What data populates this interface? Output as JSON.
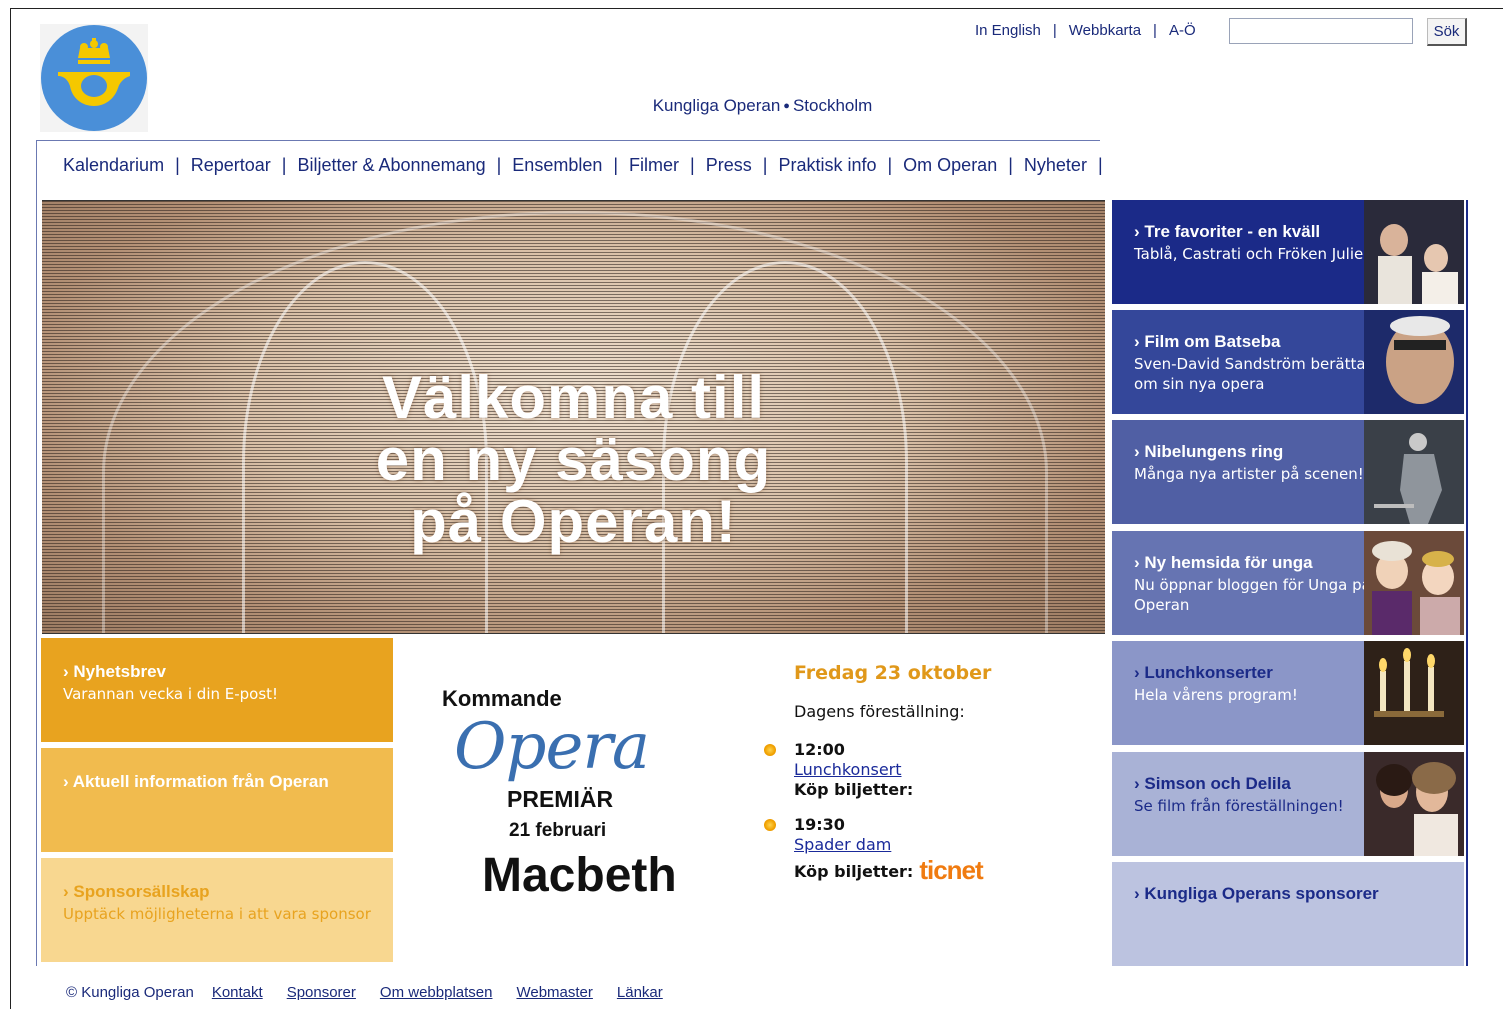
{
  "header": {
    "tagline_left": "Kungliga Operan",
    "tagline_right": "Stockholm",
    "links": [
      {
        "label": "In English"
      },
      {
        "label": "Webbkarta"
      },
      {
        "label": "A-Ö"
      }
    ],
    "search": {
      "value": "",
      "placeholder": "",
      "button_label": "Sök"
    }
  },
  "nav": {
    "items": [
      {
        "label": "Kalendarium"
      },
      {
        "label": "Repertoar"
      },
      {
        "label": "Biljetter & Abonnemang"
      },
      {
        "label": "Ensemblen"
      },
      {
        "label": "Filmer"
      },
      {
        "label": "Press"
      },
      {
        "label": "Praktisk info"
      },
      {
        "label": "Om Operan"
      },
      {
        "label": "Nyheter"
      }
    ]
  },
  "hero": {
    "lines": [
      "Välkomna till",
      "en ny säsong",
      "på Operan!"
    ]
  },
  "side_panels": [
    {
      "title": "Tre favoriter - en kväll",
      "subtitle": "Tablå, Castrati och Fröken Julie",
      "bg": "#1b2a88",
      "text_color": "#ffffff",
      "title_color": "#ffffff",
      "icon": "performers-photo"
    },
    {
      "title": "Film om Batseba",
      "subtitle": "Sven-David Sandström berättar om sin nya opera",
      "bg": "#34479a",
      "text_color": "#ffffff",
      "title_color": "#ffffff",
      "icon": "composer-photo"
    },
    {
      "title": "Nibelungens ring",
      "subtitle": "Många nya artister på scenen!",
      "bg": "#505fa4",
      "text_color": "#ffffff",
      "title_color": "#ffffff",
      "icon": "stage-photo"
    },
    {
      "title": "Ny hemsida för unga",
      "subtitle": "Nu öppnar bloggen för Unga på Operan",
      "bg": "#6674b2",
      "text_color": "#ffffff",
      "title_color": "#ffffff",
      "icon": "kids-photo"
    },
    {
      "title": "Lunchkonserter",
      "subtitle": "Hela vårens program!",
      "bg": "#8b96c8",
      "text_color": "#ffffff",
      "title_color": "#1b2a88",
      "icon": "candles-photo"
    },
    {
      "title": "Simson och Delila",
      "subtitle": "Se film från föreställningen!",
      "bg": "#a9b2d6",
      "text_color": "#1b2a88",
      "title_color": "#1b2a88",
      "icon": "couple-photo"
    },
    {
      "title": "Kungliga Operans sponsorer",
      "subtitle": "",
      "bg": "#bcc3e0",
      "text_color": "#1b2a88",
      "title_color": "#1b2a88",
      "icon": ""
    }
  ],
  "left_panels": [
    {
      "title": "Nyhetsbrev",
      "subtitle": "Varannan vecka i din E-post!",
      "bg": "#e8a31f",
      "color": "#ffffff"
    },
    {
      "title": "Aktuell information från Operan",
      "subtitle": "",
      "bg": "#f1bb4e",
      "color": "#ffffff"
    },
    {
      "title": "Sponsorsällskap",
      "subtitle": "Upptäck möjligheterna i att vara sponsor",
      "bg": "#f8d790",
      "color": "#e8a31f"
    }
  ],
  "promo": {
    "kommande": "Kommande",
    "opera": "Opera",
    "premiar": "PREMIÄR",
    "date": "21 februari",
    "title": "Macbeth"
  },
  "today": {
    "date": "Fredag 23 oktober",
    "label": "Dagens föreställning:",
    "events": [
      {
        "time": "12:00",
        "show": "Lunchkonsert",
        "buy": "Köp biljetter:",
        "vendor": ""
      },
      {
        "time": "19:30",
        "show": "Spader dam",
        "buy": "Köp biljetter:",
        "vendor": "ticnet"
      }
    ]
  },
  "footer": {
    "copyright": "© Kungliga Operan",
    "links": [
      {
        "label": "Kontakt"
      },
      {
        "label": "Sponsorer"
      },
      {
        "label": "Om webbplatsen"
      },
      {
        "label": "Webmaster"
      },
      {
        "label": "Länkar"
      }
    ]
  },
  "colors": {
    "primary": "#1b2a88",
    "accent": "#e8a31f",
    "link": "#1a2a7a"
  }
}
